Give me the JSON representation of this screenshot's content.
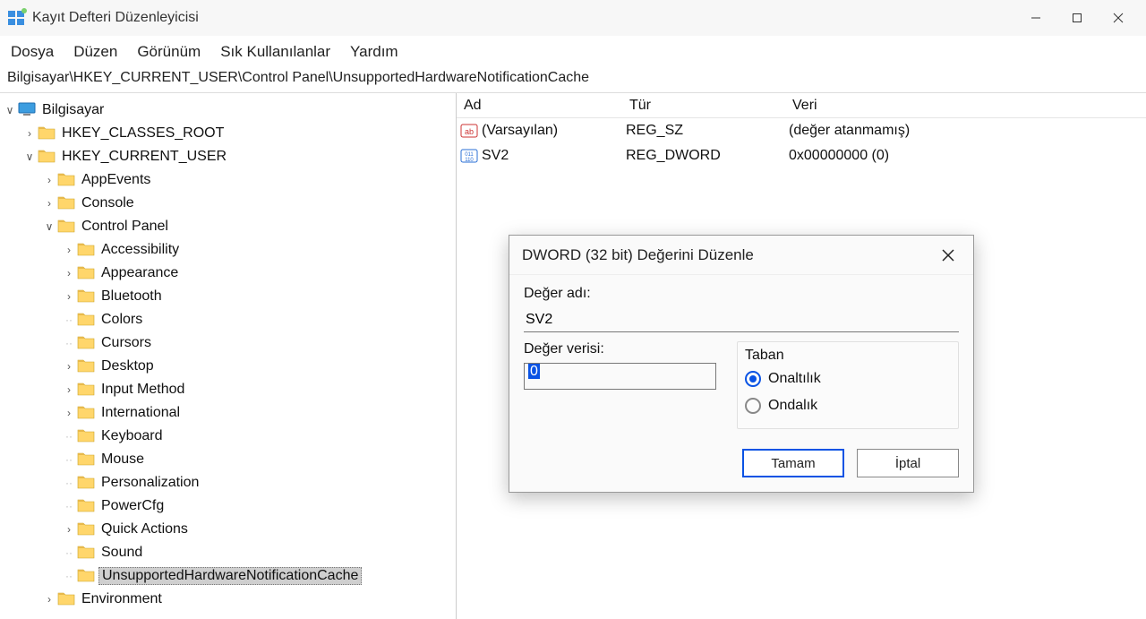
{
  "window": {
    "title": "Kayıt Defteri Düzenleyicisi"
  },
  "menu": {
    "file": "Dosya",
    "edit": "Düzen",
    "view": "Görünüm",
    "favorites": "Sık Kullanılanlar",
    "help": "Yardım"
  },
  "address": "Bilgisayar\\HKEY_CURRENT_USER\\Control Panel\\UnsupportedHardwareNotificationCache",
  "tree": {
    "root": "Bilgisayar",
    "hkcr": "HKEY_CLASSES_ROOT",
    "hkcu": "HKEY_CURRENT_USER",
    "appEvents": "AppEvents",
    "console": "Console",
    "controlPanel": "Control Panel",
    "accessibility": "Accessibility",
    "appearance": "Appearance",
    "bluetooth": "Bluetooth",
    "colors": "Colors",
    "cursors": "Cursors",
    "desktop": "Desktop",
    "inputMethod": "Input Method",
    "international": "International",
    "keyboard": "Keyboard",
    "mouse": "Mouse",
    "personalization": "Personalization",
    "powerCfg": "PowerCfg",
    "quickActions": "Quick Actions",
    "sound": "Sound",
    "uhnc": "UnsupportedHardwareNotificationCache",
    "environment": "Environment"
  },
  "list": {
    "headers": {
      "name": "Ad",
      "type": "Tür",
      "data": "Veri"
    },
    "rows": [
      {
        "name": "(Varsayılan)",
        "type": "REG_SZ",
        "data": "(değer atanmamış)",
        "icon": "string"
      },
      {
        "name": "SV2",
        "type": "REG_DWORD",
        "data": "0x00000000 (0)",
        "icon": "binary"
      }
    ]
  },
  "dialog": {
    "title": "DWORD (32 bit) Değerini Düzenle",
    "nameLabel": "Değer adı:",
    "nameValue": "SV2",
    "dataLabel": "Değer verisi:",
    "dataValue": "0",
    "baseLabel": "Taban",
    "hex": "Onaltılık",
    "dec": "Ondalık",
    "ok": "Tamam",
    "cancel": "İptal"
  }
}
